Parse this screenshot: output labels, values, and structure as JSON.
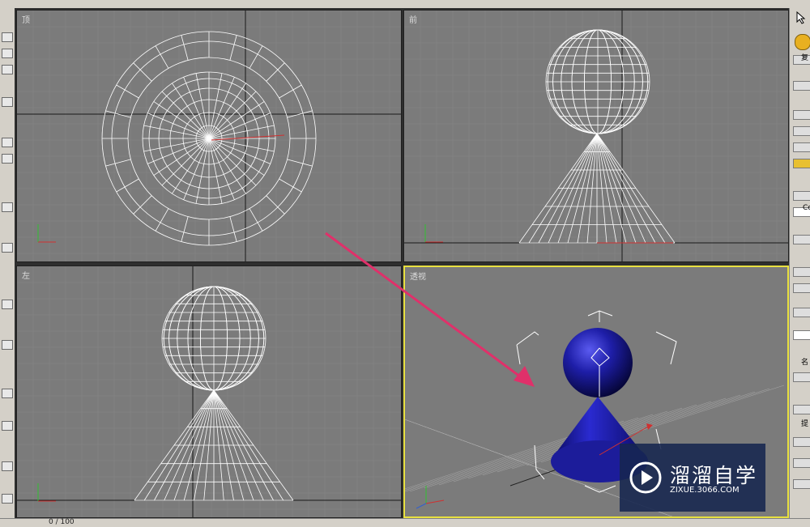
{
  "viewports": {
    "top": {
      "label": "顶"
    },
    "front": {
      "label": "前"
    },
    "left": {
      "label": "左"
    },
    "perspective": {
      "label": "透视"
    }
  },
  "command_panel": {
    "tab_char_1": "复",
    "tab_char_2": "Co",
    "tab_char_3": "名",
    "tab_char_4": "提"
  },
  "timeline": {
    "frame_counter": "0 / 100"
  },
  "watermark": {
    "title": "溜溜自学",
    "url": "ZIXUE.3066.COM"
  },
  "colors": {
    "viewport_bg": "#7b7b7b",
    "wireframe": "#ffffff",
    "active_border": "#e8e040",
    "shaded_object": "#1a1a8c",
    "arrow": "#e0306a",
    "watermark_bg": "#16264e"
  },
  "icons": [
    "select-cursor-icon",
    "logo-play-icon",
    "axis-tripod-icon",
    "arrow-annotation"
  ]
}
